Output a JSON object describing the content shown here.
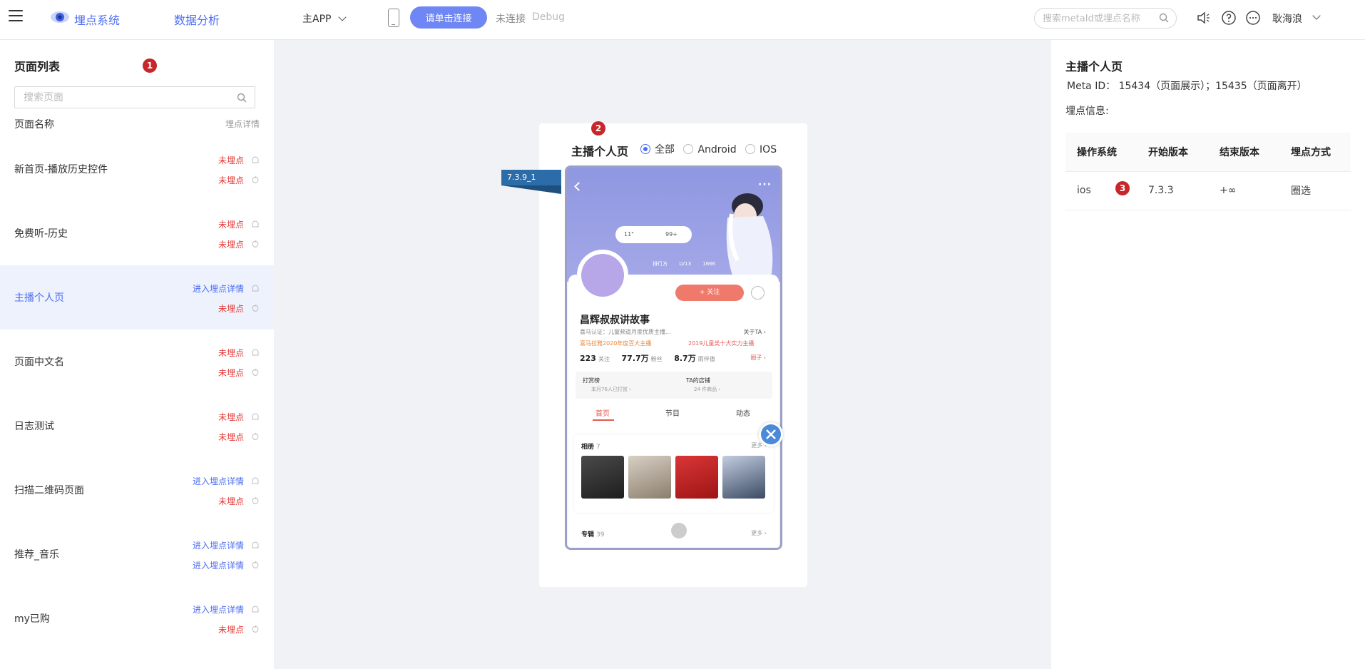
{
  "header": {
    "brand": "埋点系统",
    "nav": "数据分析",
    "app_select": "主APP",
    "connect_button": "请单击连接",
    "connection_status": "未连接",
    "debug_label": "Debug",
    "search_placeholder": "搜索metaId或埋点名称",
    "user_name": "耿海浪"
  },
  "left_panel": {
    "title": "页面列表",
    "marker": "1",
    "search_placeholder": "搜索页面",
    "col_name": "页面名称",
    "col_detail": "埋点详情",
    "items": [
      {
        "name": "新首页-播放历史控件",
        "status1": "未埋点",
        "status2": "未埋点"
      },
      {
        "name": "免费听-历史",
        "status1": "未埋点",
        "status2": "未埋点"
      },
      {
        "name": "主播个人页",
        "status1": "进入埋点详情",
        "status2": "未埋点"
      },
      {
        "name": "页面中文名",
        "status1": "未埋点",
        "status2": "未埋点"
      },
      {
        "name": "日志测试",
        "status1": "未埋点",
        "status2": "未埋点"
      },
      {
        "name": "扫描二维码页面",
        "status1": "进入埋点详情",
        "status2": "未埋点"
      },
      {
        "name": "推荐_音乐",
        "status1": "进入埋点详情",
        "status2": "进入埋点详情"
      },
      {
        "name": "my已购",
        "status1": "进入埋点详情",
        "status2": "未埋点"
      }
    ]
  },
  "preview": {
    "title": "主播个人页",
    "marker": "2",
    "radio_options": [
      "全部",
      "Android",
      "IOS"
    ],
    "selected": "全部",
    "version_tag": "7.3.9_1",
    "phone": {
      "bubble_left": "11\"",
      "bubble_right": "99+",
      "badge1": "排行方",
      "badge2": "LV13",
      "badge3": "1666",
      "follow": "+ 关注",
      "name": "昌辉叔叔讲故事",
      "cert": "喜马认证：儿童频道月度优质主播...",
      "about": "关于TA ›",
      "award1": "喜马拉雅2020年度百大主播",
      "award2": "2019儿童类十大实力主播",
      "following_num": "223",
      "following_label": "关注",
      "fans_num": "77.7万",
      "fans_label": "粉丝",
      "likes_num": "8.7万",
      "likes_label": "雨伴值",
      "circle": "圈子 ›",
      "reward": "打赏榜",
      "reward_sub": "本月76人已打赏 ›",
      "shop": "TA的店铺",
      "shop_sub": "24 件商品 ›",
      "tabs": [
        "首页",
        "节目",
        "动态"
      ],
      "album_title": "相册",
      "album_count": "7",
      "more": "更多 ›",
      "special_title": "专辑",
      "special_count": "39"
    }
  },
  "right_panel": {
    "title": "主播个人页",
    "meta": "Meta ID： 15434（页面展示）；15435（页面离开）",
    "label": "埋点信息:",
    "marker": "3",
    "columns": [
      "操作系统",
      "开始版本",
      "结束版本",
      "埋点方式"
    ],
    "rows": [
      [
        "ios",
        "7.3.3",
        "+∞",
        "圈选"
      ]
    ]
  },
  "colors": {
    "accent": "#4e6ef2",
    "missing": "#e23c39",
    "marker": "#c8262b"
  }
}
